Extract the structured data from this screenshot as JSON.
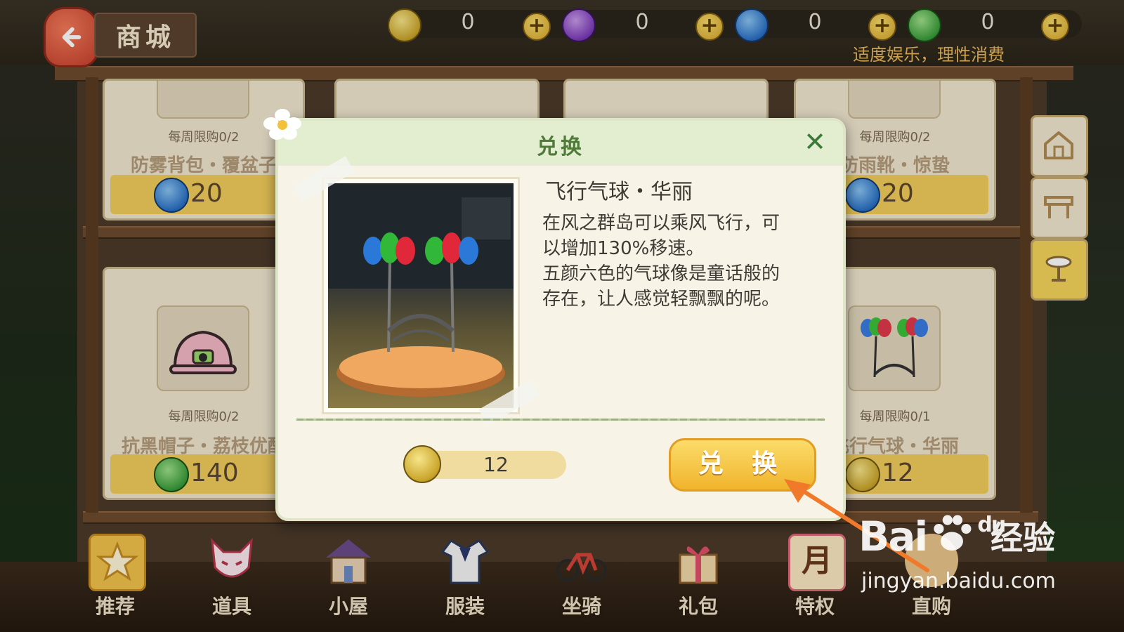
{
  "header": {
    "title": "商城",
    "notice": "适度娱乐，理性消费",
    "currencies": [
      {
        "name": "gold-coin",
        "value": "0",
        "color": "#d7b332"
      },
      {
        "name": "purple-coin",
        "value": "0",
        "color": "#7a3ab8"
      },
      {
        "name": "blue-coin",
        "value": "0",
        "color": "#2a70c4"
      },
      {
        "name": "green-coin",
        "value": "0",
        "color": "#3a9c3a"
      }
    ],
    "plus_symbol": "+"
  },
  "shop": {
    "cards": [
      {
        "limit": "每周限购0/2",
        "name": "防雾背包・覆盆子",
        "price": "20",
        "currency": "blue-coin"
      },
      {
        "limit": "每周限购0/2",
        "name": "防雨靴・惊蛰",
        "price": "20",
        "currency": "blue-coin"
      },
      {
        "limit": "每周限购0/2",
        "name": "抗黑帽子・荔枝优酪",
        "price": "140",
        "currency": "green-coin"
      },
      {
        "limit": "每周限购0/1",
        "name": "飞行气球・华丽",
        "price": "12",
        "currency": "gold-coin"
      }
    ]
  },
  "modal": {
    "title": "兑换",
    "close_symbol": "✕",
    "item_name": "飞行气球・华丽",
    "description": "在风之群岛可以乘风飞行，可\n以增加130%移速。\n五颜六色的气球像是童话般的\n存在，让人感觉轻飘飘的呢。",
    "cost": "12",
    "cost_currency": "gold-coin",
    "exchange_label": "兑 换"
  },
  "bottom_nav": {
    "items": [
      {
        "label": "推荐",
        "icon": "star-icon"
      },
      {
        "label": "道具",
        "icon": "fox-mask-icon"
      },
      {
        "label": "小屋",
        "icon": "house-icon"
      },
      {
        "label": "服装",
        "icon": "sailor-uniform-icon"
      },
      {
        "label": "坐骑",
        "icon": "bicycle-icon"
      },
      {
        "label": "礼包",
        "icon": "gift-box-icon"
      },
      {
        "label": "特权",
        "icon": "monthly-card-icon",
        "glyph": "月"
      },
      {
        "label": "直购",
        "icon": "direct-buy-icon"
      }
    ]
  },
  "side_tabs": [
    {
      "icon": "home-icon"
    },
    {
      "icon": "table-icon"
    },
    {
      "icon": "stool-icon"
    }
  ],
  "watermark": {
    "logo": "Bai",
    "logo2": "du",
    "suffix": "经验",
    "url": "jingyan.baidu.com"
  }
}
